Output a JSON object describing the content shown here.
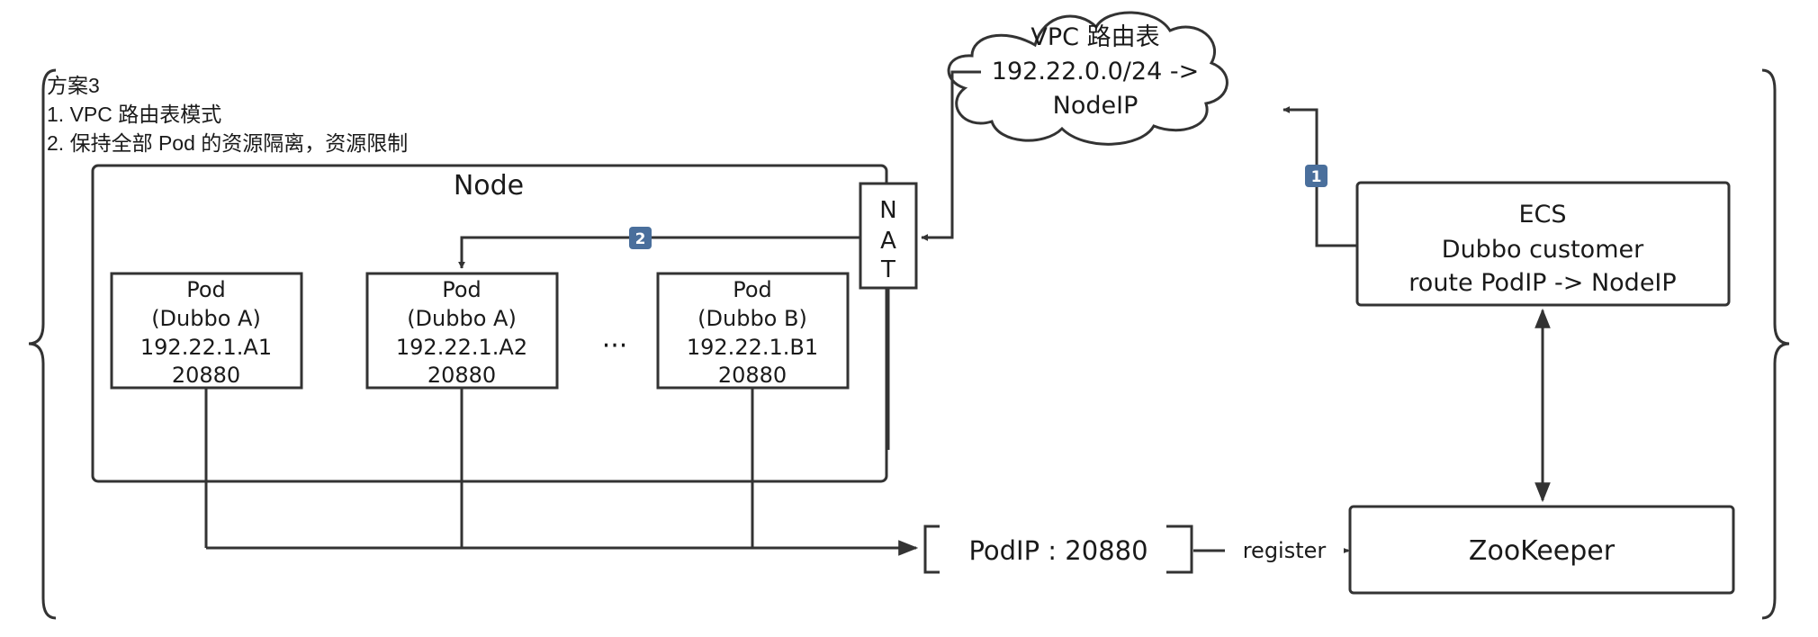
{
  "notes": {
    "title": "方案3",
    "line1": "1. VPC 路由表模式",
    "line2": "2. 保持全部 Pod 的资源隔离，资源限制"
  },
  "cloud": {
    "line1": "VPC 路由表",
    "line2": "192.22.0.0/24 ->",
    "line3": "NodeIP"
  },
  "node": {
    "label": "Node"
  },
  "nat": {
    "letters": [
      "N",
      "A",
      "T"
    ]
  },
  "pods": [
    {
      "title": "Pod",
      "app": "(Dubbo A)",
      "ip": "192.22.1.A1",
      "port": "20880"
    },
    {
      "title": "Pod",
      "app": "(Dubbo A)",
      "ip": "192.22.1.A2",
      "port": "20880"
    },
    {
      "title": "Pod",
      "app": "(Dubbo B)",
      "ip": "192.22.1.B1",
      "port": "20880"
    }
  ],
  "ellipsis": "···",
  "ecs": {
    "title": "ECS",
    "line2": "Dubbo customer",
    "line3": "route PodIP -> NodeIP"
  },
  "registry_entry": "PodIP : 20880",
  "register_label": "register",
  "zookeeper": {
    "label": "ZooKeeper"
  },
  "badges": {
    "one": "1",
    "two": "2"
  },
  "colors": {
    "line": "#333333",
    "badge": "#4a6f9c"
  }
}
